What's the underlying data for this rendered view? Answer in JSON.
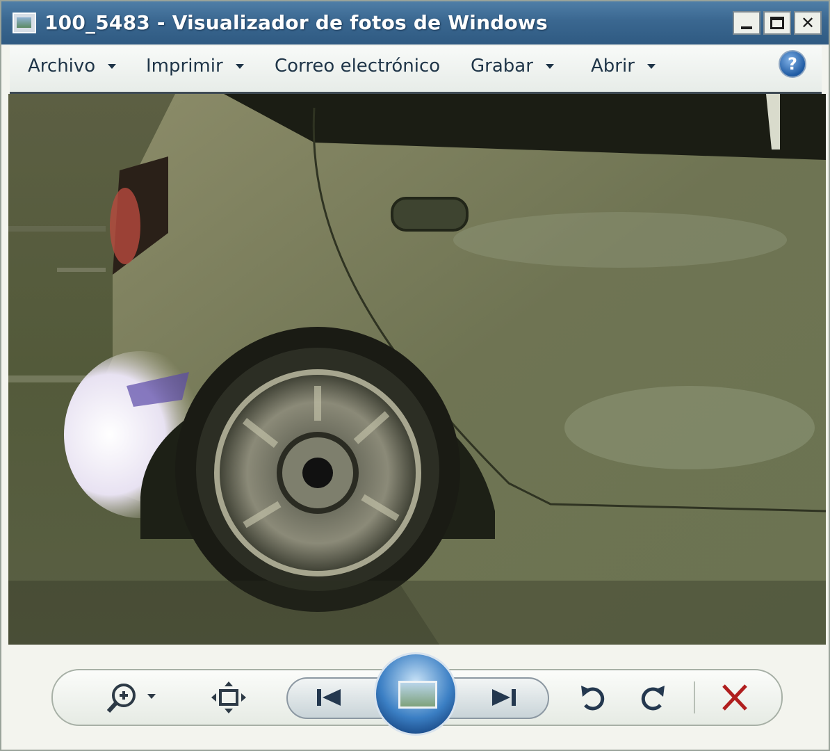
{
  "window": {
    "title": "100_5483 - Visualizador de fotos de Windows",
    "controls": {
      "minimize": "_",
      "maximize": "□",
      "close": "✕"
    }
  },
  "menu": {
    "items": [
      {
        "label": "Archivo",
        "has_dropdown": true
      },
      {
        "label": "Imprimir",
        "has_dropdown": true
      },
      {
        "label": "Correo electrónico",
        "has_dropdown": false
      },
      {
        "label": "Grabar",
        "has_dropdown": true
      },
      {
        "label": "Abrir",
        "has_dropdown": true
      }
    ],
    "help_icon": "help-icon",
    "help_glyph": "?"
  },
  "photo": {
    "subject": "car-rear-wheel-photo"
  },
  "toolbar": {
    "buttons": [
      {
        "name": "zoom",
        "icon": "zoom-icon"
      },
      {
        "name": "fit-to-window",
        "icon": "fit-window-icon"
      },
      {
        "name": "previous",
        "icon": "previous-icon"
      },
      {
        "name": "slideshow",
        "icon": "slideshow-icon"
      },
      {
        "name": "next",
        "icon": "next-icon"
      },
      {
        "name": "rotate-counterclockwise",
        "icon": "rotate-left-icon"
      },
      {
        "name": "rotate-clockwise",
        "icon": "rotate-right-icon"
      },
      {
        "name": "delete",
        "icon": "delete-icon"
      }
    ]
  },
  "colors": {
    "title_bar": "#3a6790",
    "delete_red": "#b01e1e",
    "slideshow_blue": "#3b7fc4"
  }
}
